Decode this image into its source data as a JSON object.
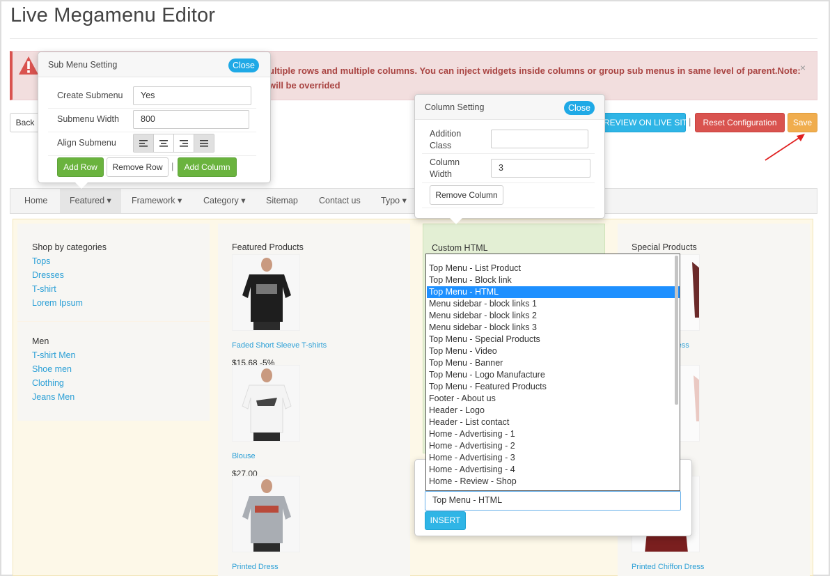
{
  "page": {
    "title": "Live Megamenu Editor"
  },
  "alert": {
    "line1": "ultiple rows and multiple columns. You can inject widgets inside columns or group sub menus in same level of parent.Note:",
    "line2": "will be overrided",
    "close": "×"
  },
  "toolbar": {
    "back": "Back",
    "preview": "REVIEW ON LIVE SITE",
    "separator": "|",
    "reset": "Reset Configuration",
    "save": "Save"
  },
  "submenu_popover": {
    "title": "Sub Menu Setting",
    "close": "Close",
    "create_label": "Create Submenu",
    "create_value": "Yes",
    "width_label": "Submenu Width",
    "width_value": "800",
    "align_label": "Align Submenu",
    "add_row": "Add Row",
    "remove_row": "Remove Row",
    "separator": "|",
    "add_column": "Add Column"
  },
  "column_popover": {
    "title": "Column Setting",
    "close": "Close",
    "class_label_1": "Addition",
    "class_label_2": "Class",
    "class_value": "",
    "width_label_1": "Column",
    "width_label_2": "Width",
    "width_value": "3",
    "remove": "Remove Column"
  },
  "nav": {
    "items": [
      {
        "label": "Home"
      },
      {
        "label": "Featured ▾"
      },
      {
        "label": "Framework ▾"
      },
      {
        "label": "Category ▾"
      },
      {
        "label": "Sitemap"
      },
      {
        "label": "Contact us"
      },
      {
        "label": "Typo ▾"
      }
    ]
  },
  "col1": {
    "group1_title": "Shop by categories",
    "group1_links": [
      "Tops",
      "Dresses",
      "T-shirt",
      "Lorem Ipsum"
    ],
    "group2_title": "Men",
    "group2_links": [
      "T-shirt Men",
      "Shoe men",
      "Clothing",
      "Jeans Men"
    ]
  },
  "col2": {
    "title": "Featured Products",
    "products": [
      {
        "name": "Faded Short Sleeve T-shirts",
        "price": "$15.68 -5%"
      },
      {
        "name": "Blouse",
        "price": "$27.00"
      },
      {
        "name": "Printed Dress"
      }
    ]
  },
  "col3": {
    "title": "Custom HTML"
  },
  "col4": {
    "title": "Special Products",
    "product1": "Dress",
    "product2": "Printed Chiffon Dress"
  },
  "widget_select": {
    "options": [
      "Top Menu - List Product",
      "Top Menu - Block link",
      "Top Menu - HTML",
      "Menu sidebar - block links 1",
      "Menu sidebar - block links 2",
      "Menu sidebar - block links 3",
      "Top Menu - Special Products",
      "Top Menu - Video",
      "Top Menu - Banner",
      "Top Menu - Logo Manufacture",
      "Top Menu - Featured Products",
      "Footer - About us",
      "Header - Logo",
      "Header - List contact",
      "Home - Advertising - 1",
      "Home - Advertising - 2",
      "Home - Advertising - 3",
      "Home - Advertising - 4",
      "Home - Review - Shop"
    ],
    "selected": "Top Menu - HTML",
    "insert": "INSERT"
  },
  "colors": {
    "accent_blue": "#1fa9e6",
    "link_blue": "#2a9fd6",
    "green": "#6ab33e",
    "red": "#d9534f",
    "orange": "#f0ad4e",
    "selected_option": "#1e90ff"
  }
}
